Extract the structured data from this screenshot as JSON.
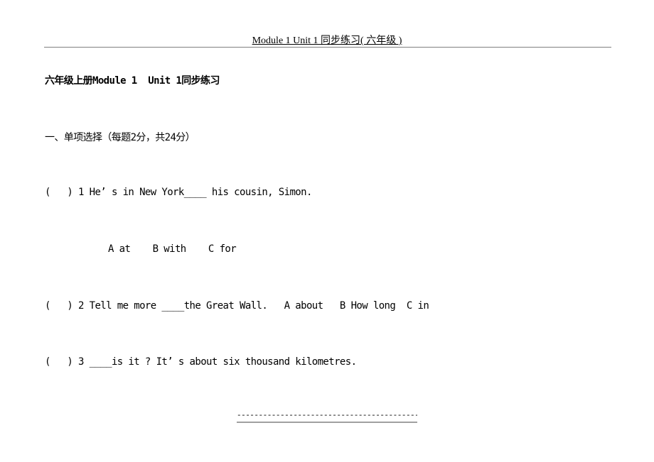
{
  "header": {
    "title": "Module 1  Unit 1 同步练习( 六年级 )"
  },
  "document": {
    "title": "六年级上册Module 1  Unit 1同步练习",
    "section_heading": "一、单项选择（每题2分，共24分）",
    "questions": [
      {
        "text": "(   ) 1 He’ s in New York____ his cousin, Simon.",
        "options_line": "A at    B with    C for"
      },
      {
        "text": "(   ) 2 Tell me more ____the Great Wall.   A about   B How long  C in"
      },
      {
        "text": "(   ) 3 ____is it ? It’ s about six thousand kilometres."
      }
    ]
  },
  "footer": {
    "dashes": "----------------------------------------------------------"
  }
}
